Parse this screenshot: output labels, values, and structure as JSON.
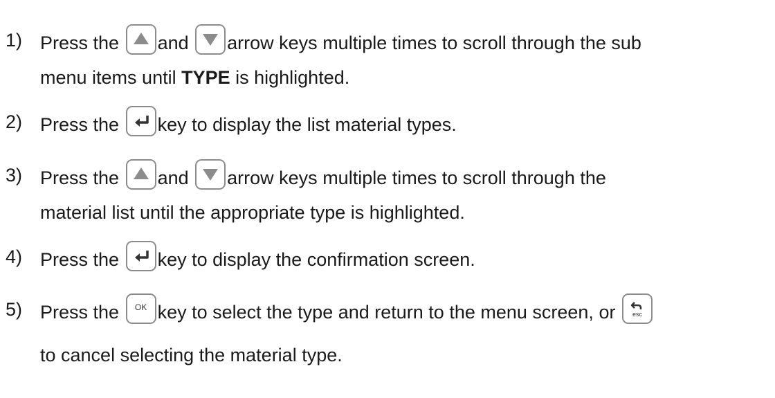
{
  "steps": [
    {
      "num": "1)",
      "t1": "Press the",
      "t2": "and",
      "t3": "arrow keys multiple times to scroll through the sub",
      "cont_pre": "menu items until ",
      "cont_bold": "TYPE",
      "cont_post": " is highlighted."
    },
    {
      "num": "2)",
      "t1": "Press the",
      "t2": "key to display the list material types."
    },
    {
      "num": "3)",
      "t1": "Press the",
      "t2": "and",
      "t3": "arrow keys multiple times to scroll through the",
      "cont": "material list until the appropriate type is highlighted."
    },
    {
      "num": "4)",
      "t1": "Press the",
      "t2": "key to display the confirmation screen."
    },
    {
      "num": "5)",
      "t1": "Press the",
      "t2": "key to select the type and return to the menu screen, or",
      "cont": "to cancel selecting the material type."
    }
  ],
  "keys": {
    "ok_label": "OK",
    "esc_label": "esc",
    "up_icon": "up-arrow-icon",
    "down_icon": "down-arrow-icon",
    "enter_icon": "enter-icon",
    "esc_icon": "esc-back-icon"
  }
}
